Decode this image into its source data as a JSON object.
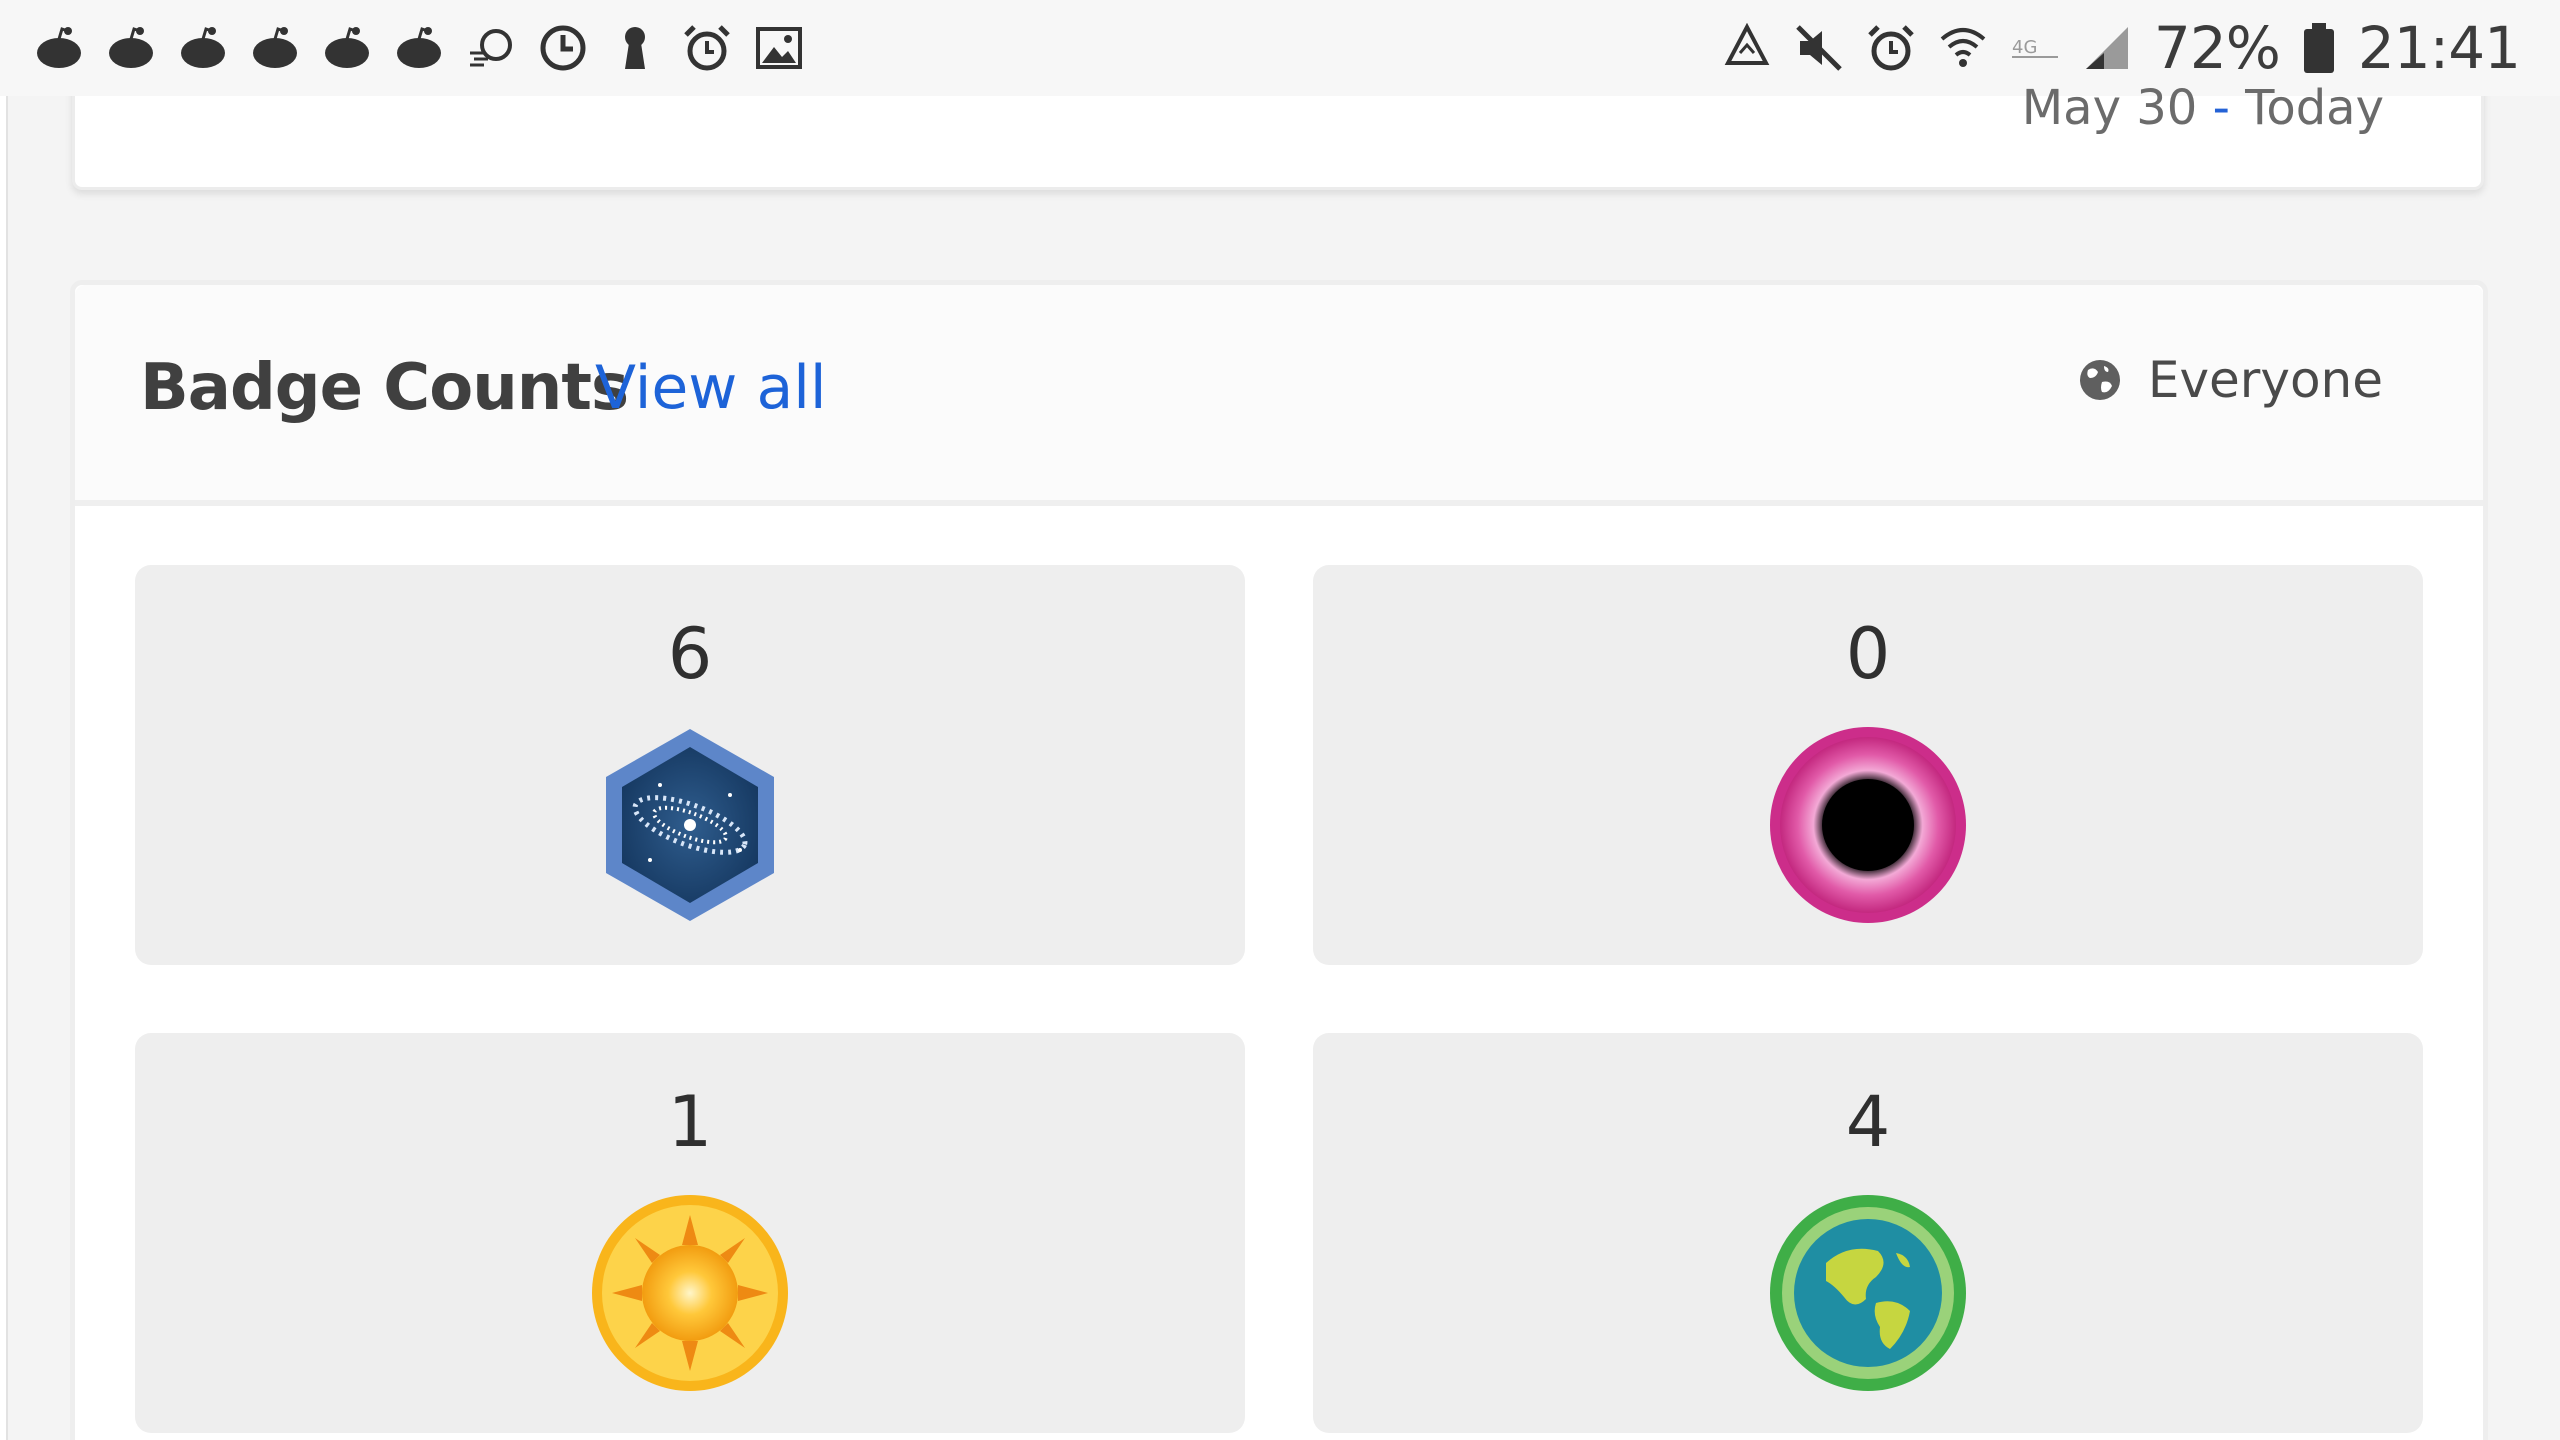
{
  "status_bar": {
    "left_icons": [
      "reddit-icon",
      "reddit-icon",
      "reddit-icon",
      "reddit-icon",
      "reddit-icon",
      "reddit-icon",
      "sync-icon",
      "clock-icon",
      "keyhole-icon",
      "alarm-icon",
      "image-icon"
    ],
    "right_icons": [
      "recycle-icon",
      "mute-icon",
      "alarm-icon",
      "wifi-icon",
      "lte-icon",
      "signal-icon"
    ],
    "battery": "72%",
    "time": "21:41"
  },
  "date_range": {
    "start": "May 30",
    "separator": "-",
    "end": "Today"
  },
  "badge_section": {
    "title": "Badge Counts",
    "view_all": "View all",
    "audience": "Everyone",
    "badges": [
      {
        "count": "6",
        "icon": "galaxy-badge-icon"
      },
      {
        "count": "0",
        "icon": "black-hole-badge-icon"
      },
      {
        "count": "1",
        "icon": "sun-badge-icon"
      },
      {
        "count": "4",
        "icon": "earth-badge-icon"
      }
    ]
  },
  "colors": {
    "link": "#1d63d8",
    "tile_bg": "#eeeeee",
    "galaxy": "#3b74c9",
    "black_hole": "#d83c9a",
    "sun": "#f6b417",
    "earth": "#4caf50"
  }
}
